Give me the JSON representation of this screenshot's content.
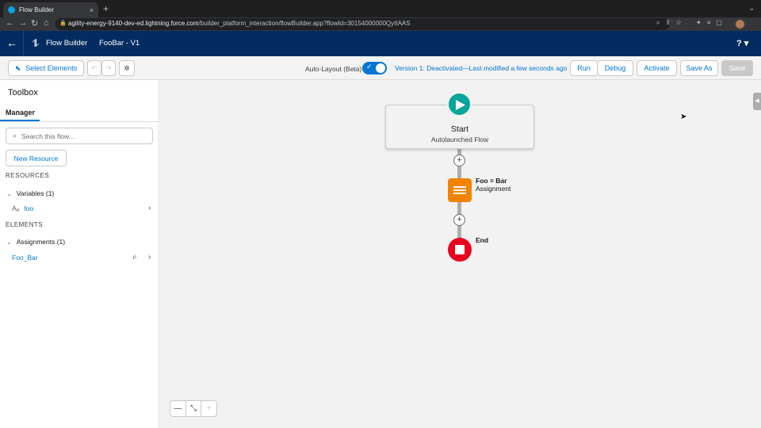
{
  "browser": {
    "tab_title": "Flow Builder",
    "tab_close": "×",
    "new_tab": "+",
    "url_host": "agility-energy-9140-dev-ed.lightning.force.com",
    "url_path": "/builder_platform_interaction/flowBuilder.app?flowId=30154000000QyIIAAS"
  },
  "header": {
    "app_name": "Flow Builder",
    "flow_name": "FooBar - V1",
    "help": "? ▾"
  },
  "toolbar": {
    "select_elements": "Select Elements",
    "auto_layout_label": "Auto-Layout (Beta)",
    "auto_layout_on": true,
    "version_status": "Version 1: Deactivated—Last modified a few seconds ago",
    "run": "Run",
    "debug": "Debug",
    "activate": "Activate",
    "save_as": "Save As",
    "save": "Save"
  },
  "toolbox": {
    "title": "Toolbox",
    "tab": "Manager",
    "search_placeholder": "Search this flow...",
    "new_resource": "New Resource",
    "resources_heading": "RESOURCES",
    "variables_group": "Variables (1)",
    "variable_item": "foo",
    "elements_heading": "ELEMENTS",
    "assignments_group": "Assignments (1)",
    "assignment_item": "Foo_Bar"
  },
  "canvas": {
    "start_title": "Start",
    "start_subtitle": "Autolaunched Flow",
    "assignment_name": "Foo = Bar",
    "assignment_type": "Assignment",
    "end_label": "End"
  },
  "colors": {
    "header_bg": "#032d60",
    "brand_blue": "#0176d3",
    "start_teal": "#06a59a",
    "assignment_orange": "#f38303",
    "end_red": "#ea001e"
  }
}
